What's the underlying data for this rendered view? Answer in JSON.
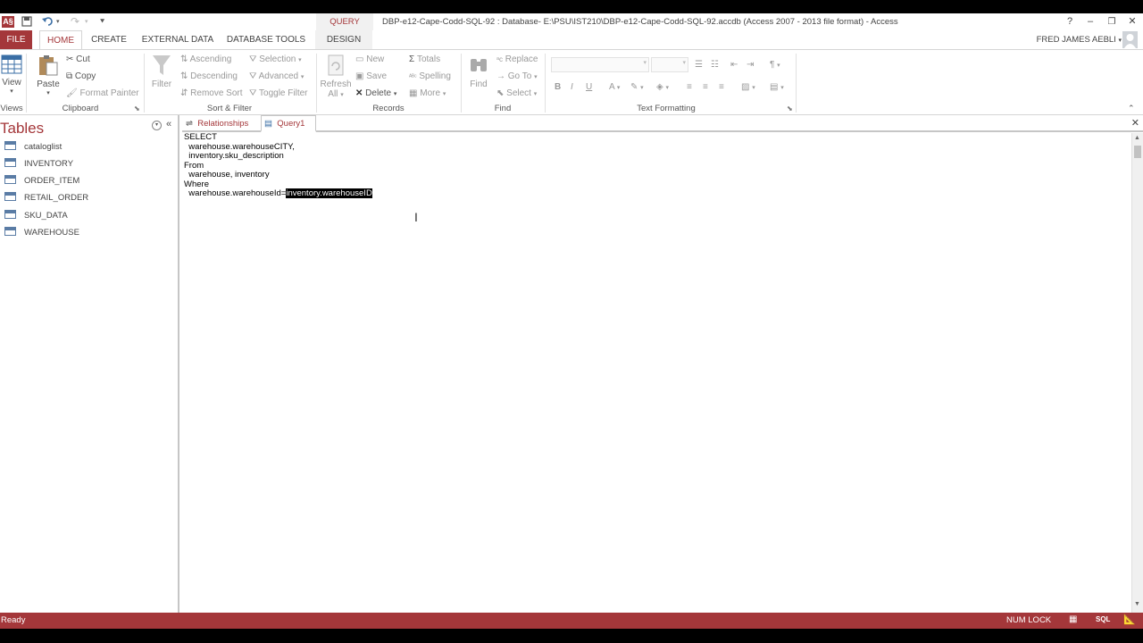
{
  "title_bar": {
    "app_icon": "A§",
    "query_tools": "QUERY TOOLS",
    "window_title": "DBP-e12-Cape-Codd-SQL-92 : Database- E:\\PSU\\IST210\\DBP-e12-Cape-Codd-SQL-92.accdb (Access 2007 - 2013 file format) - Access",
    "help": "?",
    "minimize": "–",
    "restore": "❐",
    "close": "✕"
  },
  "ribbon_tabs": {
    "file": "FILE",
    "home": "HOME",
    "create": "CREATE",
    "external_data": "EXTERNAL DATA",
    "database_tools": "DATABASE TOOLS",
    "design": "DESIGN",
    "user": "FRED JAMES AEBLI"
  },
  "ribbon": {
    "views": {
      "view": "View",
      "label": "Views"
    },
    "clipboard": {
      "paste": "Paste",
      "cut": "Cut",
      "copy": "Copy",
      "format_painter": "Format Painter",
      "label": "Clipboard"
    },
    "sort_filter": {
      "filter": "Filter",
      "ascending": "Ascending",
      "descending": "Descending",
      "remove_sort": "Remove Sort",
      "selection": "Selection",
      "advanced": "Advanced",
      "toggle_filter": "Toggle Filter",
      "label": "Sort & Filter"
    },
    "records": {
      "refresh": "Refresh",
      "refresh_all": "All",
      "new": "New",
      "save": "Save",
      "delete": "Delete",
      "totals": "Totals",
      "spelling": "Spelling",
      "more": "More",
      "label": "Records"
    },
    "find": {
      "find": "Find",
      "replace": "Replace",
      "goto": "Go To",
      "select": "Select",
      "label": "Find"
    },
    "text_formatting": {
      "bold": "B",
      "italic": "I",
      "underline": "U",
      "font_color": "A",
      "label": "Text Formatting"
    }
  },
  "nav": {
    "title": "Tables",
    "items": [
      "cataloglist",
      "INVENTORY",
      "ORDER_ITEM",
      "RETAIL_ORDER",
      "SKU_DATA",
      "WAREHOUSE"
    ]
  },
  "doc_tabs": [
    "Relationships",
    "Query1"
  ],
  "sql": {
    "line1": "SELECT",
    "line2": "  warehouse.warehouseCITY,",
    "line3": "  inventory.sku_description",
    "line4": "From",
    "line5": "  warehouse, inventory",
    "line6": "Where",
    "line7_pre": "  warehouse.warehouseId=",
    "line7_sel": "inventory.warehouseID"
  },
  "status": {
    "left": "Ready",
    "numlock": "NUM LOCK"
  },
  "colors": {
    "accent": "#a4373a"
  }
}
